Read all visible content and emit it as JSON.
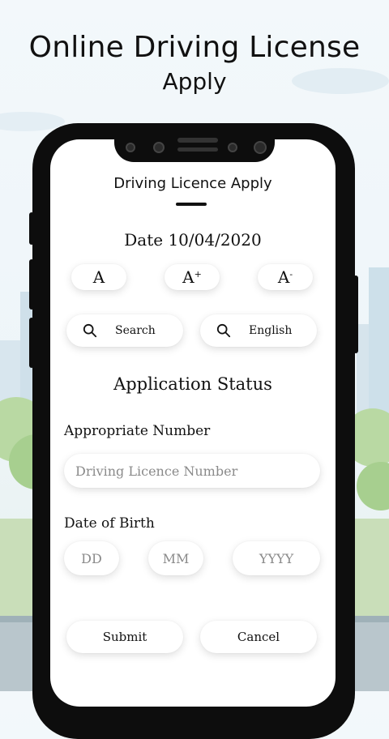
{
  "promo": {
    "title_line1": "Online Driving License",
    "title_line2": "Apply"
  },
  "app": {
    "title": "Driving Licence Apply",
    "date_text": "Date 10/04/2020"
  },
  "font_controls": {
    "normal": "A",
    "increase": "A",
    "increase_mark": "+",
    "decrease": "A",
    "decrease_mark": "-"
  },
  "tools": {
    "search_label": "Search",
    "language_label": "English",
    "icon": "search-icon"
  },
  "section_title": "Application Status",
  "form": {
    "number_label": "Appropriate Number",
    "number_placeholder": "Driving Licence Number",
    "dob_label": "Date of Birth",
    "day_placeholder": "DD",
    "month_placeholder": "MM",
    "year_placeholder": "YYYY"
  },
  "actions": {
    "submit_label": "Submit",
    "cancel_label": "Cancel"
  },
  "colors": {
    "background": "#eef5f9",
    "phone_frame": "#0d0d0d",
    "screen": "#ffffff",
    "text": "#111111",
    "placeholder": "#8a8a8a"
  }
}
